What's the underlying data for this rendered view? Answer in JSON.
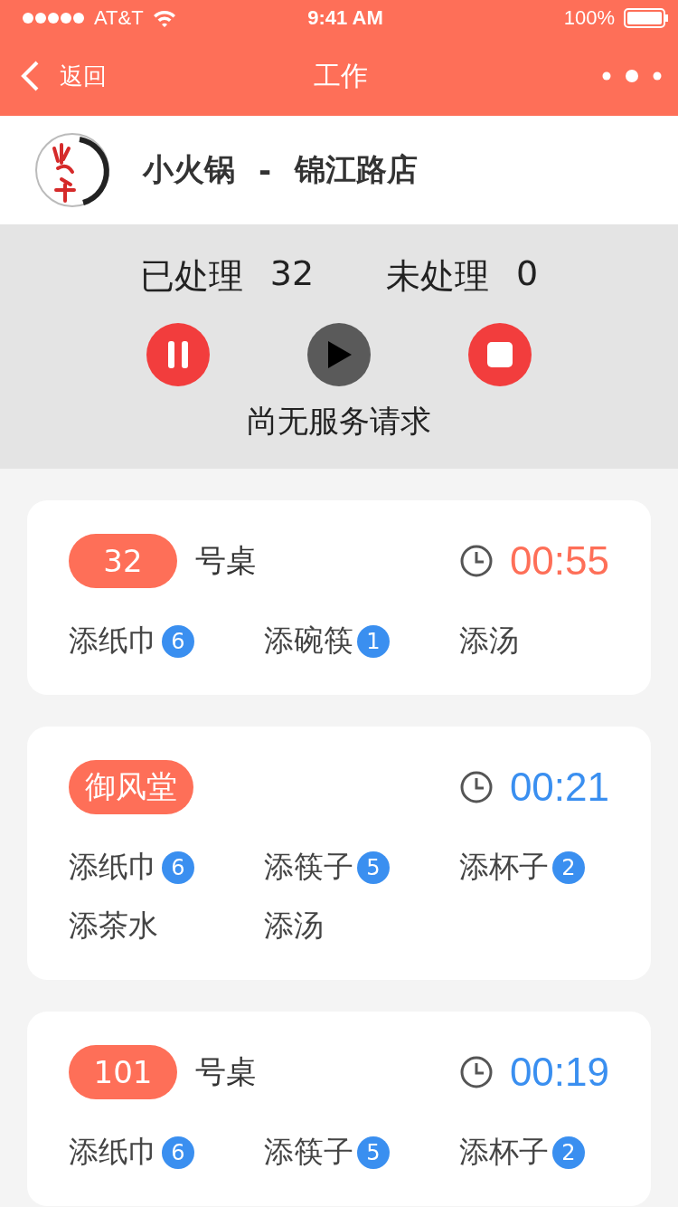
{
  "status_bar": {
    "carrier": "AT&T",
    "time": "9:41 AM",
    "battery": "100%"
  },
  "nav": {
    "back": "返回",
    "title": "工作"
  },
  "store": {
    "name": "小火锅",
    "separator": "-",
    "branch": "锦江路店"
  },
  "summary": {
    "done_label": "已处理",
    "done": "32",
    "pending_label": "未处理",
    "pending": "0"
  },
  "controls": [
    {
      "kind": "pause",
      "disabled": false
    },
    {
      "kind": "play",
      "disabled": true
    },
    {
      "kind": "stop",
      "disabled": false
    }
  ],
  "message": "尚无服务请求",
  "requests": [
    {
      "table": "32",
      "suffix": "号桌",
      "time": "00:55",
      "urgent": true,
      "items": [
        {
          "label": "添纸巾",
          "count": "6"
        },
        {
          "label": "添碗筷",
          "count": "1"
        },
        {
          "label": "添汤"
        }
      ]
    },
    {
      "table": "御风堂",
      "time": "00:21",
      "urgent": false,
      "items": [
        {
          "label": "添纸巾",
          "count": "6"
        },
        {
          "label": "添筷子",
          "count": "5"
        },
        {
          "label": "添杯子",
          "count": "2"
        },
        {
          "label": "添茶水"
        },
        {
          "label": "添汤"
        }
      ]
    },
    {
      "table": "101",
      "suffix": "号桌",
      "time": "00:19",
      "urgent": false,
      "items": [
        {
          "label": "添纸巾",
          "count": "6"
        },
        {
          "label": "添筷子",
          "count": "5"
        },
        {
          "label": "添杯子",
          "count": "2"
        }
      ]
    }
  ]
}
